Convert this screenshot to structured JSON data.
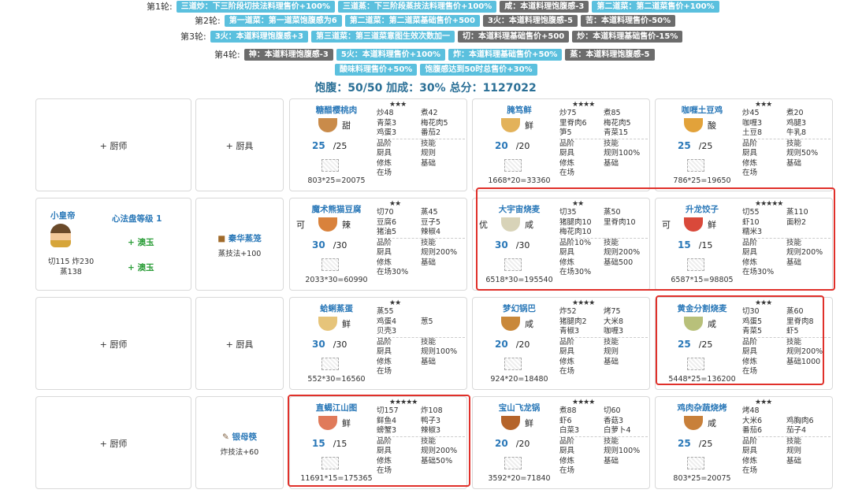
{
  "rules": [
    {
      "round": "第1轮:",
      "tags": [
        {
          "text": "三道炒：下三阶段切技法料理售价+100%",
          "tone": "blue"
        },
        {
          "text": "三道蒸：下三阶段蒸技法料理售价+100%",
          "tone": "blue"
        },
        {
          "text": "咸：本道料理饱腹感-3",
          "tone": "gray"
        },
        {
          "text": "第二道菜：第二道菜售价+100%",
          "tone": "blue"
        }
      ]
    },
    {
      "round": "第2轮:",
      "tags": [
        {
          "text": "第一道菜：第一道菜饱腹感为6",
          "tone": "blue"
        },
        {
          "text": "第二道菜：第二道菜基础售价+500",
          "tone": "blue"
        },
        {
          "text": "3火：本道料理饱腹感-5",
          "tone": "gray"
        },
        {
          "text": "苦：本道料理售价-50%",
          "tone": "gray"
        }
      ]
    },
    {
      "round": "第3轮:",
      "tags": [
        {
          "text": "3火：本道料理饱腹感+3",
          "tone": "blue"
        },
        {
          "text": "第三道菜：第三道菜意图生效次数加一",
          "tone": "blue"
        },
        {
          "text": "切：本道料理基础售价+500",
          "tone": "gray"
        },
        {
          "text": "炒：本道料理基础售价-15%",
          "tone": "gray"
        }
      ]
    },
    {
      "round": "第4轮:",
      "tags": [
        {
          "text": "神：本道料理饱腹感-3",
          "tone": "gray"
        },
        {
          "text": "5火：本道料理售价+100%",
          "tone": "blue"
        },
        {
          "text": "炸：本道料理基础售价+50%",
          "tone": "blue"
        },
        {
          "text": "蒸：本道料理饱腹感-5",
          "tone": "gray"
        }
      ]
    },
    {
      "round": "",
      "tags": [
        {
          "text": "酸味料理售价+50%",
          "tone": "blue"
        },
        {
          "text": "饱腹感达到50时总售价+30%",
          "tone": "blue"
        }
      ]
    }
  ],
  "summary": "饱腹：50/50 加成：30% 总分：1127022",
  "empty": {
    "chef": "+ 厨师",
    "equip": "+ 厨具"
  },
  "chef": {
    "name": "小皇帝",
    "stats_line1": "切115  炸230",
    "stats_line2": "蒸138",
    "level": "心法盘等级 1",
    "jade1": "+ 澳玉",
    "jade2": "+ 澳玉",
    "equip_name": "秦华蒸笼",
    "equip_effect": "蒸技法+100"
  },
  "chef4": {
    "equip_name": "银母筷",
    "equip_effect": "炸技法+60"
  },
  "dishes": [
    {
      "name": "糖醋樱桃肉",
      "stars": "★★★",
      "rank": "",
      "flavor": "甜",
      "qty": "25",
      "max": "/25",
      "total": "803*25=20075",
      "icon_color": "#c98b4a",
      "rows": [
        [
          "炒48",
          "煮42"
        ],
        [
          "青菜3",
          "梅花肉5"
        ],
        [
          "鸡蛋3",
          "番茄2"
        ]
      ],
      "info": [
        [
          "品阶",
          "技能"
        ],
        [
          "厨具",
          "规则"
        ],
        [
          "修炼",
          "基础"
        ],
        [
          "在场",
          ""
        ]
      ]
    },
    {
      "name": "腌笃鲜",
      "stars": "★★★★",
      "rank": "",
      "flavor": "鲜",
      "qty": "20",
      "max": "/20",
      "total": "1668*20=33360",
      "icon_color": "#e3b25a",
      "rows": [
        [
          "炒75",
          "煮85"
        ],
        [
          "里脊肉6",
          "梅花肉5"
        ],
        [
          "笋5",
          "青菜15"
        ]
      ],
      "info": [
        [
          "品阶",
          "技能"
        ],
        [
          "厨具",
          "规则100%"
        ],
        [
          "修炼",
          "基础"
        ],
        [
          "在场",
          ""
        ]
      ]
    },
    {
      "name": "咖喱土豆鸡",
      "stars": "★★★",
      "rank": "",
      "flavor": "酸",
      "qty": "25",
      "max": "/25",
      "total": "786*25=19650",
      "icon_color": "#e2a23a",
      "rows": [
        [
          "炒45",
          "煮20"
        ],
        [
          "咖喱3",
          "鸡腿3"
        ],
        [
          "土豆8",
          "牛乳8"
        ]
      ],
      "info": [
        [
          "品阶",
          "技能"
        ],
        [
          "厨具",
          "规则50%"
        ],
        [
          "修炼",
          "基础"
        ],
        [
          "在场",
          ""
        ]
      ]
    },
    {
      "name": "魔术熊猫豆腐",
      "stars": "★★",
      "rank": "可",
      "flavor": "辣",
      "qty": "30",
      "max": "/30",
      "total": "2033*30=60990",
      "icon_color": "#d9823c",
      "rows": [
        [
          "切70",
          "蒸45"
        ],
        [
          "豆腐6",
          "豆子5"
        ],
        [
          "猪油5",
          "辣椒4"
        ]
      ],
      "info": [
        [
          "品阶",
          "技能"
        ],
        [
          "厨具",
          "规则200%"
        ],
        [
          "修炼",
          "基础"
        ],
        [
          "在场30%",
          ""
        ]
      ]
    },
    {
      "name": "大宇宙烧麦",
      "stars": "★★",
      "rank": "优",
      "flavor": "咸",
      "qty": "30",
      "max": "/30",
      "total": "6518*30=195540",
      "icon_color": "#d8d3b8",
      "rows": [
        [
          "切35",
          "蒸50"
        ],
        [
          "猪腿肉10",
          "里脊肉10"
        ],
        [
          "梅花肉10",
          ""
        ]
      ],
      "info": [
        [
          "品阶10%",
          "技能"
        ],
        [
          "厨具",
          "规则200%"
        ],
        [
          "修炼",
          "基础500"
        ],
        [
          "在场30%",
          ""
        ]
      ]
    },
    {
      "name": "升龙饺子",
      "stars": "★★★★★",
      "rank": "可",
      "flavor": "鲜",
      "qty": "15",
      "max": "/15",
      "total": "6587*15=98805",
      "icon_color": "#d9493a",
      "rows": [
        [
          "切55",
          "蒸110"
        ],
        [
          "虾10",
          "面粉2"
        ],
        [
          "糯米3",
          ""
        ]
      ],
      "info": [
        [
          "品阶",
          "技能"
        ],
        [
          "厨具",
          "规则200%"
        ],
        [
          "修炼",
          "基础"
        ],
        [
          "在场30%",
          ""
        ]
      ]
    },
    {
      "name": "蛤蜊蒸蛋",
      "stars": "★★",
      "rank": "",
      "flavor": "鲜",
      "qty": "30",
      "max": "/30",
      "total": "552*30=16560",
      "icon_color": "#e6c47a",
      "rows": [
        [
          "蒸55",
          ""
        ],
        [
          "鸡蛋4",
          "葱5"
        ],
        [
          "贝壳3",
          ""
        ]
      ],
      "info": [
        [
          "品阶",
          "技能"
        ],
        [
          "厨具",
          "规则100%"
        ],
        [
          "修炼",
          "基础"
        ],
        [
          "在场",
          ""
        ]
      ]
    },
    {
      "name": "梦幻锅巴",
      "stars": "★★★★",
      "rank": "",
      "flavor": "咸",
      "qty": "20",
      "max": "/20",
      "total": "924*20=18480",
      "icon_color": "#c9883a",
      "rows": [
        [
          "炸52",
          "烤75"
        ],
        [
          "猪腿肉2",
          "大米8"
        ],
        [
          "青椒3",
          "咖喱3"
        ]
      ],
      "info": [
        [
          "品阶",
          "技能"
        ],
        [
          "厨具",
          "规则"
        ],
        [
          "修炼",
          "基础"
        ],
        [
          "在场",
          ""
        ]
      ]
    },
    {
      "name": "黄金分割烧麦",
      "stars": "★★★",
      "rank": "",
      "flavor": "咸",
      "qty": "25",
      "max": "/25",
      "total": "5448*25=136200",
      "icon_color": "#b8c07a",
      "rows": [
        [
          "切30",
          "蒸60"
        ],
        [
          "鸡蛋5",
          "里脊肉8"
        ],
        [
          "青菜5",
          "虾5"
        ]
      ],
      "info": [
        [
          "品阶",
          "技能"
        ],
        [
          "厨具",
          "规则200%"
        ],
        [
          "修炼",
          "基础1000"
        ],
        [
          "在场",
          ""
        ]
      ]
    },
    {
      "name": "直蝎江山图",
      "stars": "★★★★★",
      "rank": "",
      "flavor": "鲜",
      "qty": "15",
      "max": "/15",
      "total": "11691*15=175365",
      "icon_color": "#e07a5a",
      "rows": [
        [
          "切157",
          "炸108"
        ],
        [
          "鲜鱼4",
          "鸭子3"
        ],
        [
          "螃蟹3",
          "辣椒3"
        ]
      ],
      "info": [
        [
          "品阶",
          "技能"
        ],
        [
          "厨具",
          "规则200%"
        ],
        [
          "修炼",
          "基础50%"
        ],
        [
          "在场",
          ""
        ]
      ]
    },
    {
      "name": "宝山飞龙锅",
      "stars": "★★★★",
      "rank": "",
      "flavor": "鲜",
      "qty": "20",
      "max": "/20",
      "total": "3592*20=71840",
      "icon_color": "#b5642a",
      "rows": [
        [
          "煮88",
          "切60"
        ],
        [
          "虾6",
          "香菇3"
        ],
        [
          "白菜3",
          "白萝卜4"
        ]
      ],
      "info": [
        [
          "品阶",
          "技能"
        ],
        [
          "厨具",
          "规则100%"
        ],
        [
          "修炼",
          "基础"
        ],
        [
          "在场",
          ""
        ]
      ]
    },
    {
      "name": "鸡肉杂蔬烧烤",
      "stars": "★★★",
      "rank": "",
      "flavor": "咸",
      "qty": "25",
      "max": "/25",
      "total": "803*25=20075",
      "icon_color": "#c8803a",
      "rows": [
        [
          "烤48",
          ""
        ],
        [
          "大米6",
          "鸡胸肉6"
        ],
        [
          "番茄6",
          "茄子4"
        ]
      ],
      "info": [
        [
          "品阶",
          "技能"
        ],
        [
          "厨具",
          "规则"
        ],
        [
          "修炼",
          "基础"
        ],
        [
          "在场",
          ""
        ]
      ]
    }
  ]
}
